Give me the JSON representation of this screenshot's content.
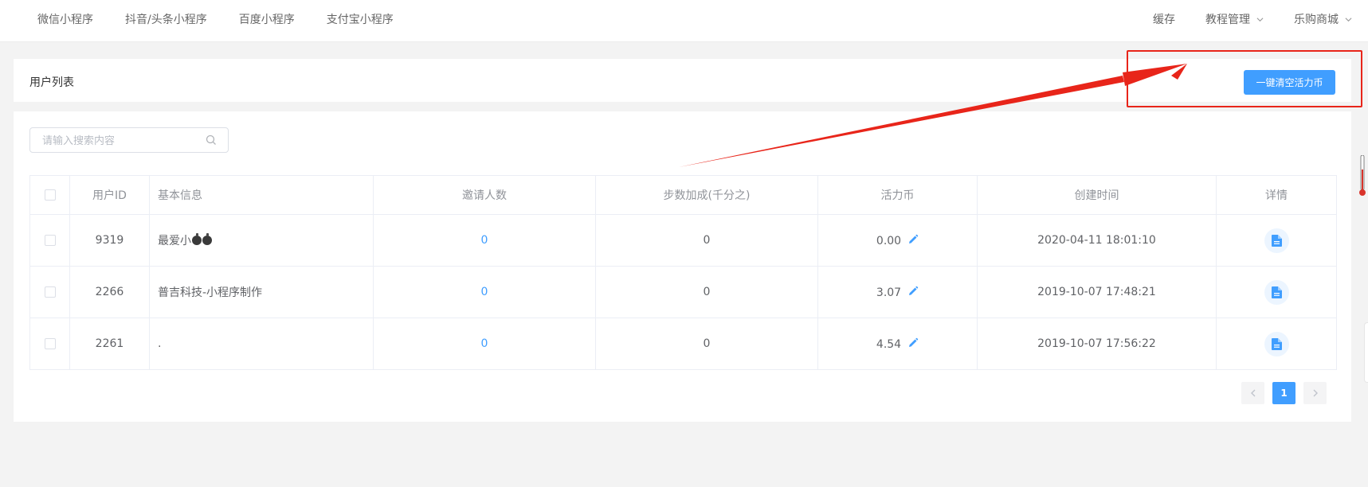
{
  "nav": {
    "left": [
      "微信小程序",
      "抖音/头条小程序",
      "百度小程序",
      "支付宝小程序"
    ],
    "right": {
      "cache": "缓存",
      "tutorial": "教程管理",
      "mall": "乐购商城"
    }
  },
  "page": {
    "title": "用户列表",
    "clear_button": "一键清空活力币"
  },
  "search": {
    "placeholder": "请输入搜索内容",
    "value": ""
  },
  "table": {
    "headers": {
      "id": "用户ID",
      "info": "基本信息",
      "invites": "邀请人数",
      "steps": "步数加成(千分之)",
      "coins": "活力币",
      "created": "创建时间",
      "detail": "详情"
    },
    "rows": [
      {
        "id": "9319",
        "info": "最爱小",
        "invites": "0",
        "steps": "0",
        "coins": "0.00",
        "created": "2020-04-11 18:01:10"
      },
      {
        "id": "2266",
        "info": "普吉科技-小程序制作",
        "invites": "0",
        "steps": "0",
        "coins": "3.07",
        "created": "2019-10-07 17:48:21"
      },
      {
        "id": "2261",
        "info": ".",
        "invites": "0",
        "steps": "0",
        "coins": "4.54",
        "created": "2019-10-07 17:56:22"
      }
    ]
  },
  "pagination": {
    "current": "1",
    "prev_icon": "chevron-left-icon",
    "next_icon": "chevron-right-icon"
  },
  "colors": {
    "primary": "#409eff",
    "annotation": "#e8251a",
    "background": "#f3f3f3"
  }
}
